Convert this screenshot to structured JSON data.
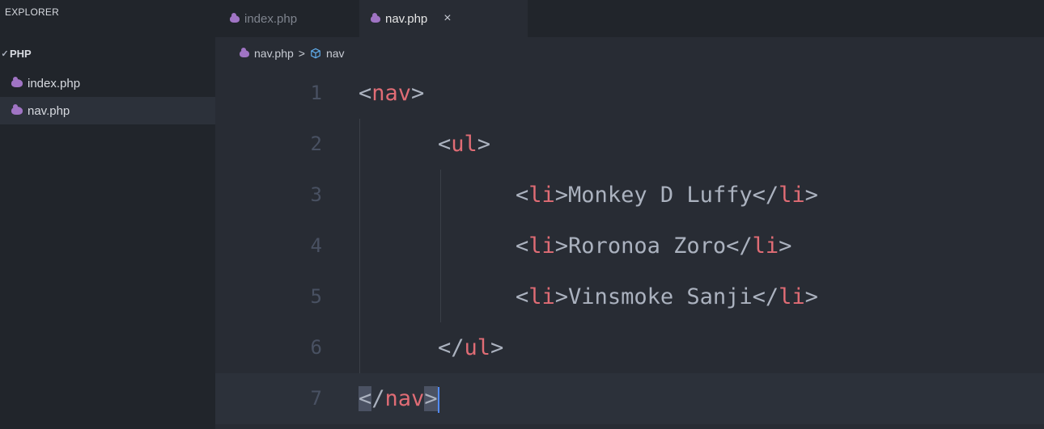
{
  "sidebar": {
    "title": "EXPLORER",
    "folder": "PHP",
    "files": [
      "index.php",
      "nav.php"
    ]
  },
  "tabs": [
    {
      "label": "index.php",
      "active": false
    },
    {
      "label": "nav.php",
      "active": true,
      "close": "×"
    }
  ],
  "breadcrumb": {
    "file": "nav.php",
    "separator": ">",
    "symbol": "nav"
  },
  "editor": {
    "line_numbers": [
      "1",
      "2",
      "3",
      "4",
      "5",
      "6",
      "7"
    ],
    "lines": [
      {
        "open": "<",
        "tag": "nav",
        "close": ">"
      },
      {
        "open": "<",
        "tag": "ul",
        "close": ">"
      },
      {
        "tag_open": "li",
        "text": "Monkey D Luffy",
        "tag_close": "li"
      },
      {
        "tag_open": "li",
        "text": "Roronoa Zoro",
        "tag_close": "li"
      },
      {
        "tag_open": "li",
        "text": "Vinsmoke Sanji",
        "tag_close": "li"
      },
      {
        "open": "</",
        "tag": "ul",
        "close": ">"
      },
      {
        "open": "</",
        "tag": "nav",
        "close": ">"
      }
    ],
    "current_line": 7
  },
  "colors": {
    "background": "#282c34",
    "sidebar": "#21252b",
    "tag": "#e06c75",
    "text": "#abb2bf",
    "line_number": "#495162",
    "cursor": "#528bff"
  }
}
